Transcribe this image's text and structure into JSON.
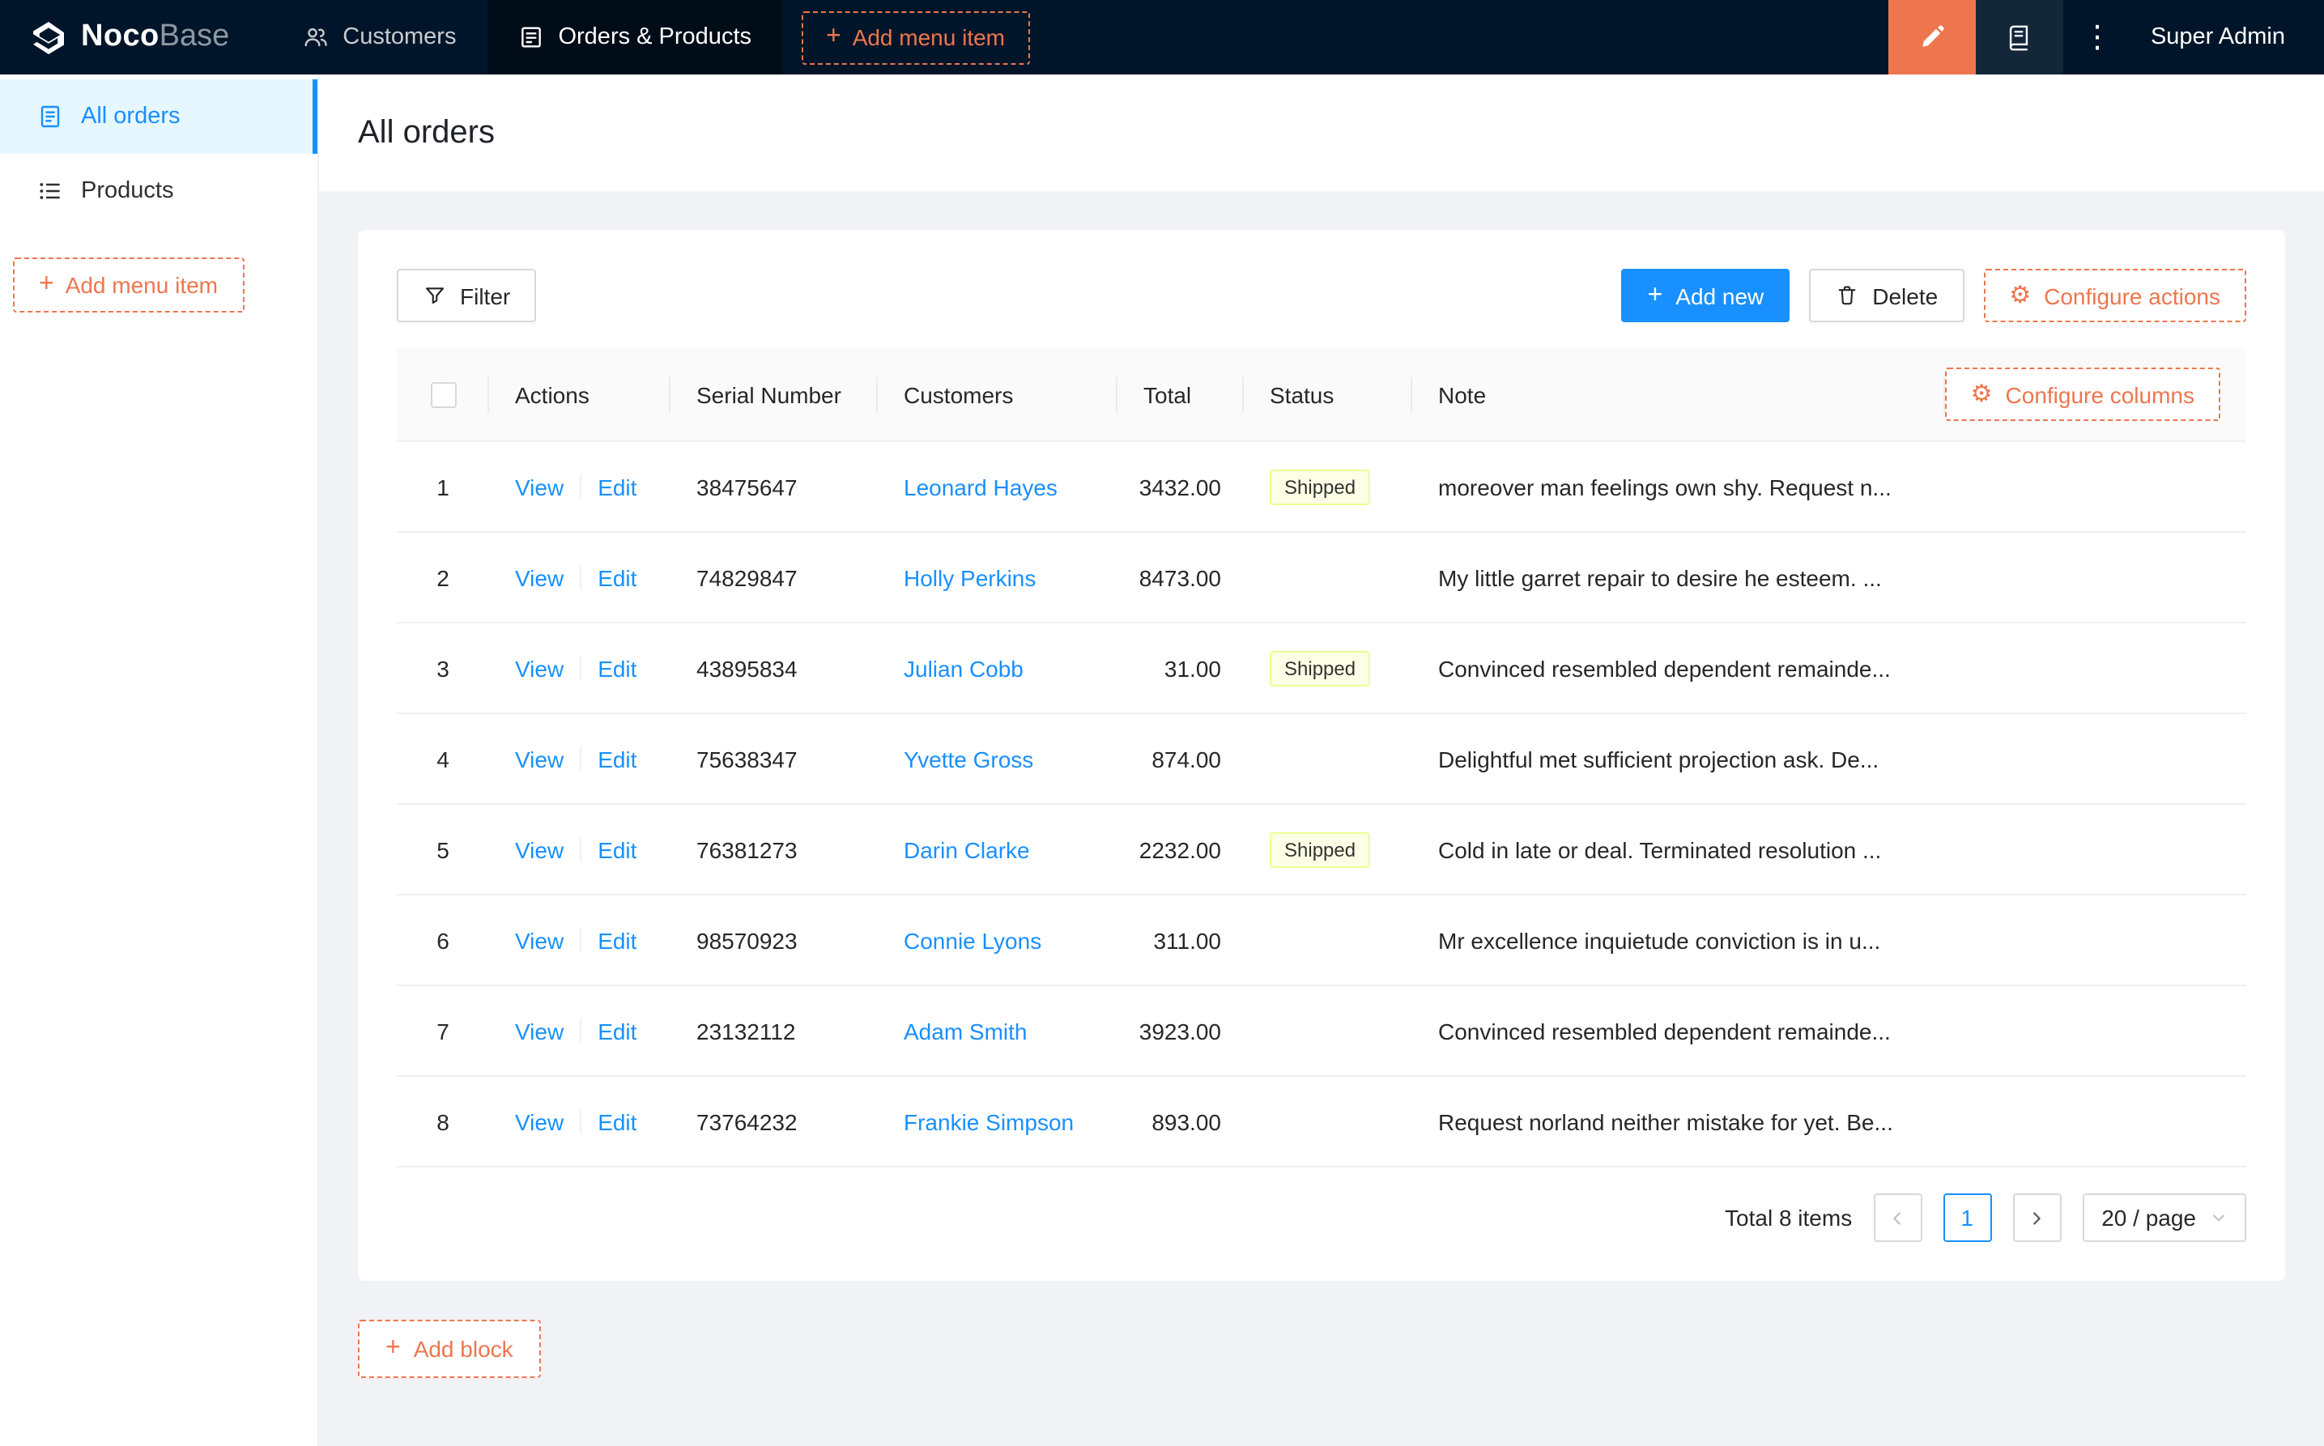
{
  "header": {
    "logo": {
      "part1": "Noco",
      "part2": "Base"
    },
    "nav": [
      {
        "label": "Customers"
      },
      {
        "label": "Orders & Products"
      }
    ],
    "add_menu_item": "Add menu item",
    "user": "Super Admin"
  },
  "sidebar": {
    "items": [
      {
        "label": "All orders"
      },
      {
        "label": "Products"
      }
    ],
    "add_menu_item": "Add menu item"
  },
  "page": {
    "title": "All orders",
    "add_block": "Add block"
  },
  "toolbar": {
    "filter": "Filter",
    "add_new": "Add new",
    "delete": "Delete",
    "configure_actions": "Configure actions"
  },
  "table": {
    "configure_columns": "Configure columns",
    "columns": {
      "actions": "Actions",
      "serial": "Serial Number",
      "customers": "Customers",
      "total": "Total",
      "status": "Status",
      "note": "Note"
    },
    "action_labels": {
      "view": "View",
      "edit": "Edit"
    },
    "rows": [
      {
        "index": "1",
        "serial": "38475647",
        "customer": "Leonard Hayes",
        "total": "3432.00",
        "status": "Shipped",
        "note": "moreover man feelings own shy. Request n..."
      },
      {
        "index": "2",
        "serial": "74829847",
        "customer": "Holly Perkins",
        "total": "8473.00",
        "status": "",
        "note": "My little garret repair to desire he esteem. ..."
      },
      {
        "index": "3",
        "serial": "43895834",
        "customer": "Julian Cobb",
        "total": "31.00",
        "status": "Shipped",
        "note": "Convinced resembled dependent remainde..."
      },
      {
        "index": "4",
        "serial": "75638347",
        "customer": "Yvette Gross",
        "total": "874.00",
        "status": "",
        "note": "Delightful met sufficient projection ask. De..."
      },
      {
        "index": "5",
        "serial": "76381273",
        "customer": "Darin Clarke",
        "total": "2232.00",
        "status": "Shipped",
        "note": "Cold in late or deal. Terminated resolution ..."
      },
      {
        "index": "6",
        "serial": "98570923",
        "customer": "Connie Lyons",
        "total": "311.00",
        "status": "",
        "note": "Mr excellence inquietude conviction is in u..."
      },
      {
        "index": "7",
        "serial": "23132112",
        "customer": "Adam Smith",
        "total": "3923.00",
        "status": "",
        "note": "Convinced resembled dependent remainde..."
      },
      {
        "index": "8",
        "serial": "73764232",
        "customer": "Frankie Simpson",
        "total": "893.00",
        "status": "",
        "note": "Request norland neither mistake for yet. Be..."
      }
    ]
  },
  "pagination": {
    "total": "Total 8 items",
    "page": "1",
    "page_size": "20 / page"
  },
  "icons": {
    "plus": "+",
    "gear": "⚙",
    "ellipsis": "⋮"
  },
  "colors": {
    "accent_orange": "#ed764e",
    "primary_blue": "#1890ff",
    "header_bg": "#001529",
    "selected_tab_bg": "#000c17",
    "sidebar_selected_bg": "#e6f7ff",
    "tag_bg": "#fcffe6",
    "tag_border": "#eaff8f"
  }
}
